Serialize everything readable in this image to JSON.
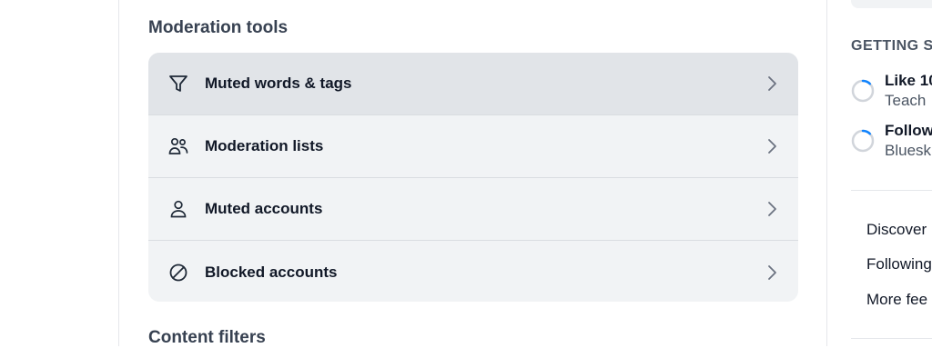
{
  "moderation": {
    "title": "Moderation tools",
    "items": [
      {
        "label": "Muted words & tags",
        "icon": "filter-icon"
      },
      {
        "label": "Moderation lists",
        "icon": "users-icon"
      },
      {
        "label": "Muted accounts",
        "icon": "person-icon"
      },
      {
        "label": "Blocked accounts",
        "icon": "block-icon"
      }
    ]
  },
  "content_filters": {
    "title": "Content filters"
  },
  "sidebar": {
    "getting_started": {
      "heading": "GETTING S",
      "items": [
        {
          "title": "Like 10",
          "subtitle": "Teach"
        },
        {
          "title": "Follow",
          "subtitle": "Bluesk"
        }
      ]
    },
    "feeds": [
      "Discover",
      "Following",
      "More fee"
    ]
  },
  "colors": {
    "accent": "#1083fe",
    "card_bg": "#f1f3f5",
    "row_active_bg": "#e1e4e8",
    "divider": "#e5e7eb"
  }
}
